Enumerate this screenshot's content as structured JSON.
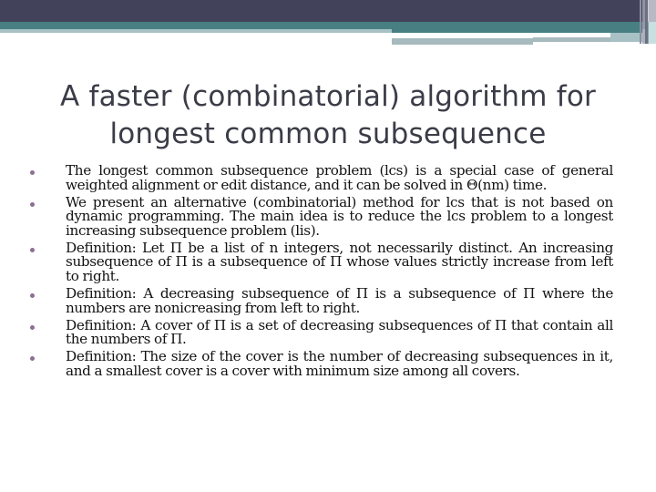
{
  "slide": {
    "title": "A faster (combinatorial) algorithm for longest common subsequence",
    "title_lines": [
      "A faster (combinatorial) algorithm for",
      "longest common subsequence"
    ],
    "bullets": [
      {
        "icon": "bullet-dot-icon",
        "text": "The longest common subsequence problem (lcs) is a special case of general weighted alignment or edit distance, and it can be solved in Θ(nm) time."
      },
      {
        "icon": "bullet-dot-icon",
        "text": "We present an alternative (combinatorial) method for lcs that is not based on dynamic programming. The main idea is to reduce the lcs problem to a longest increasing subsequence problem (lis)."
      },
      {
        "icon": "bullet-dot-icon",
        "text": "Definition: Let Π be a list of n integers, not necessarily distinct. An increasing subsequence of Π is a subsequence of Π whose values strictly increase from left to right."
      },
      {
        "icon": "bullet-dot-icon",
        "text": "Definition: A decreasing subsequence of Π is a subsequence of Π where the numbers are nonicreasing from left to right."
      },
      {
        "icon": "bullet-dot-icon",
        "text": "Definition: A cover of Π is a set of decreasing subsequences of Π that contain all the numbers of Π."
      },
      {
        "icon": "bullet-dot-icon",
        "text": "Definition: The size of the cover is the number of decreasing subsequences in it, and a smallest cover is a cover with minimum size among all covers."
      }
    ]
  },
  "colors": {
    "header_dark": "#42435a",
    "header_teal": "#477f82",
    "header_light": "#a7c1c4",
    "title_text": "#3b3c47",
    "body_text": "#111111",
    "bullet": "#8c6f93",
    "background": "#ffffff"
  }
}
